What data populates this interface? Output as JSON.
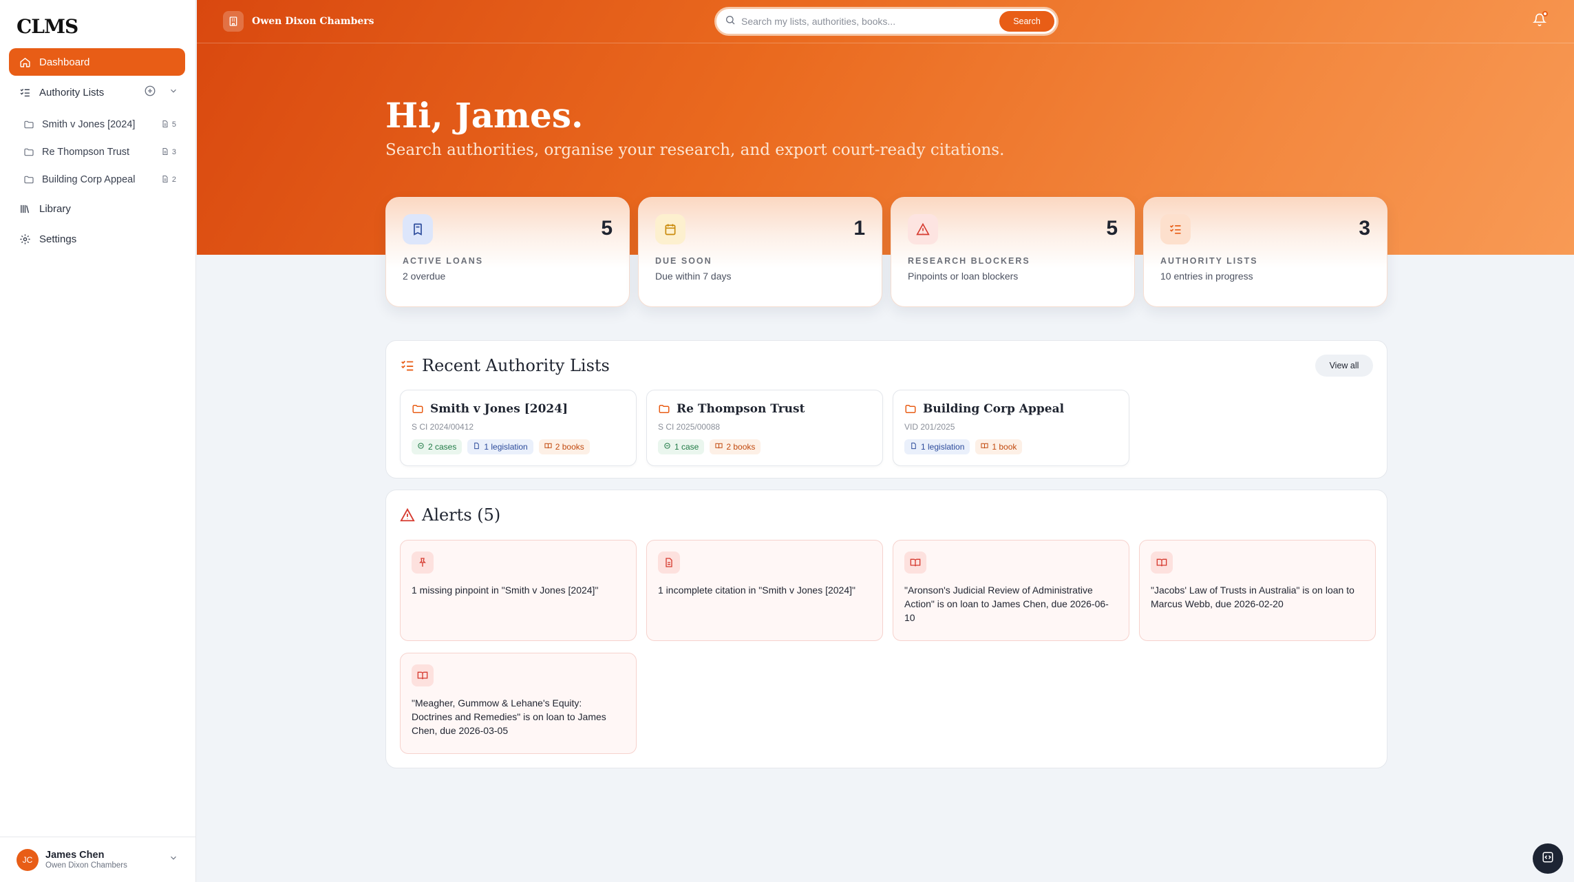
{
  "app": {
    "logo": "CLMS"
  },
  "sidebar": {
    "dashboard": "Dashboard",
    "authority_lists": "Authority Lists",
    "lists": [
      {
        "label": "Smith v Jones [2024]",
        "count": "5"
      },
      {
        "label": "Re Thompson Trust",
        "count": "3"
      },
      {
        "label": "Building Corp Appeal",
        "count": "2"
      }
    ],
    "library": "Library",
    "settings": "Settings"
  },
  "user": {
    "initials": "JC",
    "name": "James Chen",
    "org": "Owen Dixon Chambers"
  },
  "topbar": {
    "chambers": "Owen Dixon Chambers",
    "search_placeholder": "Search my lists, authorities, books...",
    "search_button": "Search"
  },
  "hero": {
    "greeting": "Hi, James.",
    "subtitle": "Search authorities, organise your research, and export court-ready citations."
  },
  "stats": [
    {
      "title": "ACTIVE LOANS",
      "value": "5",
      "sub": "2 overdue",
      "icon": "book-icon",
      "color": "#2b4a9b",
      "bg": "#dde6fb"
    },
    {
      "title": "DUE SOON",
      "value": "1",
      "sub": "Due within 7 days",
      "icon": "calendar-icon",
      "color": "#c98a0b",
      "bg": "#fdf0cf"
    },
    {
      "title": "RESEARCH BLOCKERS",
      "value": "5",
      "sub": "Pinpoints or loan blockers",
      "icon": "warning-icon",
      "color": "#d63a2f",
      "bg": "#fde4e1"
    },
    {
      "title": "AUTHORITY LISTS",
      "value": "3",
      "sub": "10 entries in progress",
      "icon": "checklist-icon",
      "color": "#e85d16",
      "bg": "#fde0cd"
    }
  ],
  "recent": {
    "title": "Recent Authority Lists",
    "view_all": "View all",
    "cards": [
      {
        "title": "Smith v Jones [2024]",
        "ref": "S CI 2024/00412",
        "cases": "2 cases",
        "legislation": "1 legislation",
        "books": "2 books"
      },
      {
        "title": "Re Thompson Trust",
        "ref": "S CI 2025/00088",
        "cases": "1 case",
        "books": "2 books"
      },
      {
        "title": "Building Corp Appeal",
        "ref": "VID 201/2025",
        "legislation": "1 legislation",
        "books": "1 book"
      }
    ]
  },
  "alerts": {
    "title": "Alerts (5)",
    "items": [
      {
        "text": "1 missing pinpoint in \"Smith v Jones [2024]\"",
        "icon": "pin-icon"
      },
      {
        "text": "1 incomplete citation in \"Smith v Jones [2024]\"",
        "icon": "document-icon"
      },
      {
        "text": "\"Aronson's Judicial Review of Administrative Action\" is on loan to James Chen, due 2026-06-10",
        "icon": "open-book-icon"
      },
      {
        "text": "\"Jacobs' Law of Trusts in Australia\" is on loan to Marcus Webb, due 2026-02-20",
        "icon": "open-book-icon"
      },
      {
        "text": "\"Meagher, Gummow & Lehane's Equity: Doctrines and Remedies\" is on loan to James Chen, due 2026-03-05",
        "icon": "open-book-icon"
      }
    ]
  },
  "colors": {
    "accent": "#e85d16",
    "danger": "#d63a2f"
  }
}
